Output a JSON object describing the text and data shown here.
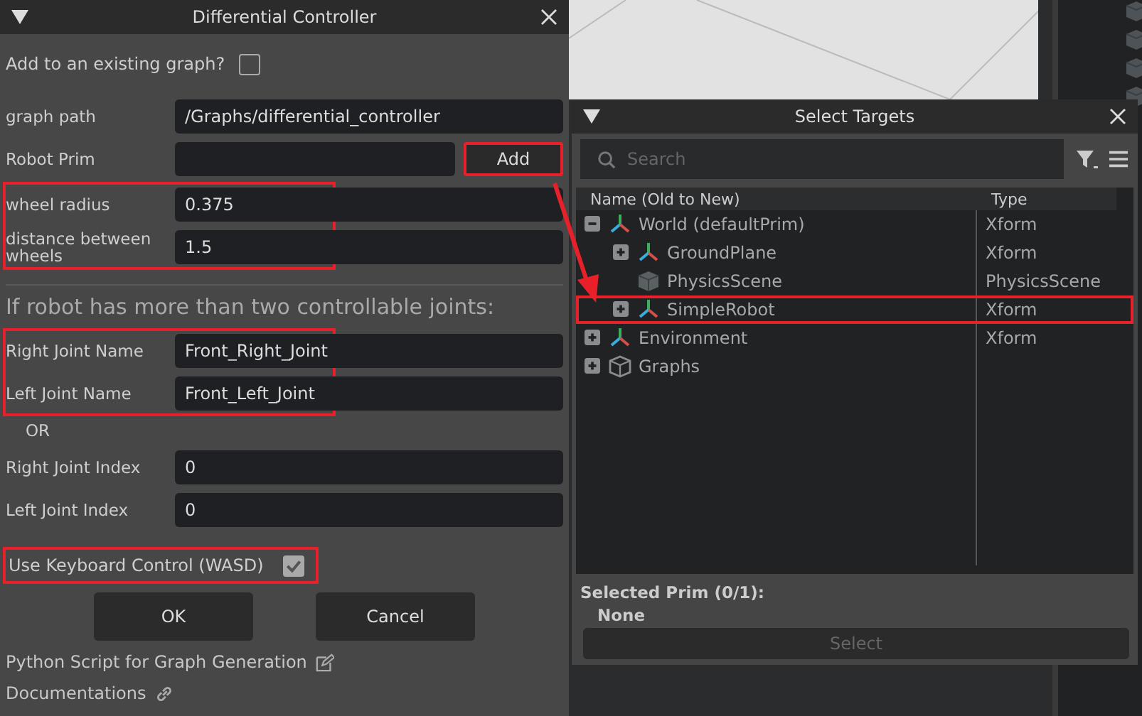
{
  "left_dialog": {
    "title": "Differential Controller",
    "existing_graph": {
      "label": "Add to an existing graph?",
      "checked": false
    },
    "groups": [
      {
        "highlighted": false,
        "fields": [
          {
            "label": "graph path",
            "value": "/Graphs/differential_controller"
          },
          {
            "label": "Robot Prim",
            "button": {
              "label": "Add",
              "highlighted": true
            }
          }
        ]
      },
      {
        "highlighted": true,
        "fields": [
          {
            "label": "wheel radius",
            "value": "0.375"
          },
          {
            "label": "distance between wheels",
            "value": "1.5"
          }
        ]
      }
    ],
    "joints_heading": "If robot has more than two controllable joints:",
    "joint_groups": [
      {
        "highlighted": true,
        "fields": [
          {
            "label": "Right Joint Name",
            "value": "Front_Right_Joint"
          },
          {
            "label": "Left Joint Name",
            "value": "Front_Left_Joint"
          }
        ]
      },
      {
        "highlighted": false,
        "fields": [
          {
            "label": "Right Joint Index",
            "value": "0"
          },
          {
            "label": "Left Joint Index",
            "value": "0"
          }
        ]
      }
    ],
    "or_label": "OR",
    "keyboard": {
      "label": "Use Keyboard Control (WASD)",
      "checked": true,
      "highlighted": true
    },
    "buttons": [
      "OK",
      "Cancel"
    ],
    "links": [
      {
        "label": "Python Script for Graph Generation",
        "kind": "edit"
      },
      {
        "label": "Documentations",
        "kind": "link"
      }
    ]
  },
  "select_dialog": {
    "title": "Select Targets",
    "search": {
      "placeholder": "Search"
    },
    "columns": [
      "Name (Old to New)",
      "Type"
    ],
    "tree": [
      {
        "name": "World (defaultPrim)",
        "type": "Xform",
        "kind": "xform",
        "expanded": true,
        "highlighted": false,
        "children": [
          {
            "name": "GroundPlane",
            "type": "Xform",
            "kind": "xform",
            "expanded": false,
            "highlighted": false
          },
          {
            "name": "PhysicsScene",
            "type": "PhysicsScene",
            "kind": "scene",
            "highlighted": false
          },
          {
            "name": "SimpleRobot",
            "type": "Xform",
            "kind": "xform",
            "expanded": false,
            "highlighted": true
          }
        ]
      },
      {
        "name": "Environment",
        "type": "Xform",
        "kind": "xform",
        "expanded": false,
        "highlighted": false
      },
      {
        "name": "Graphs",
        "kind": "scope",
        "expanded": false,
        "highlighted": false
      }
    ],
    "selected_label": "Selected Prim (0/1):",
    "selected_value": "None",
    "select_button": {
      "label": "Select",
      "disabled": true
    }
  }
}
